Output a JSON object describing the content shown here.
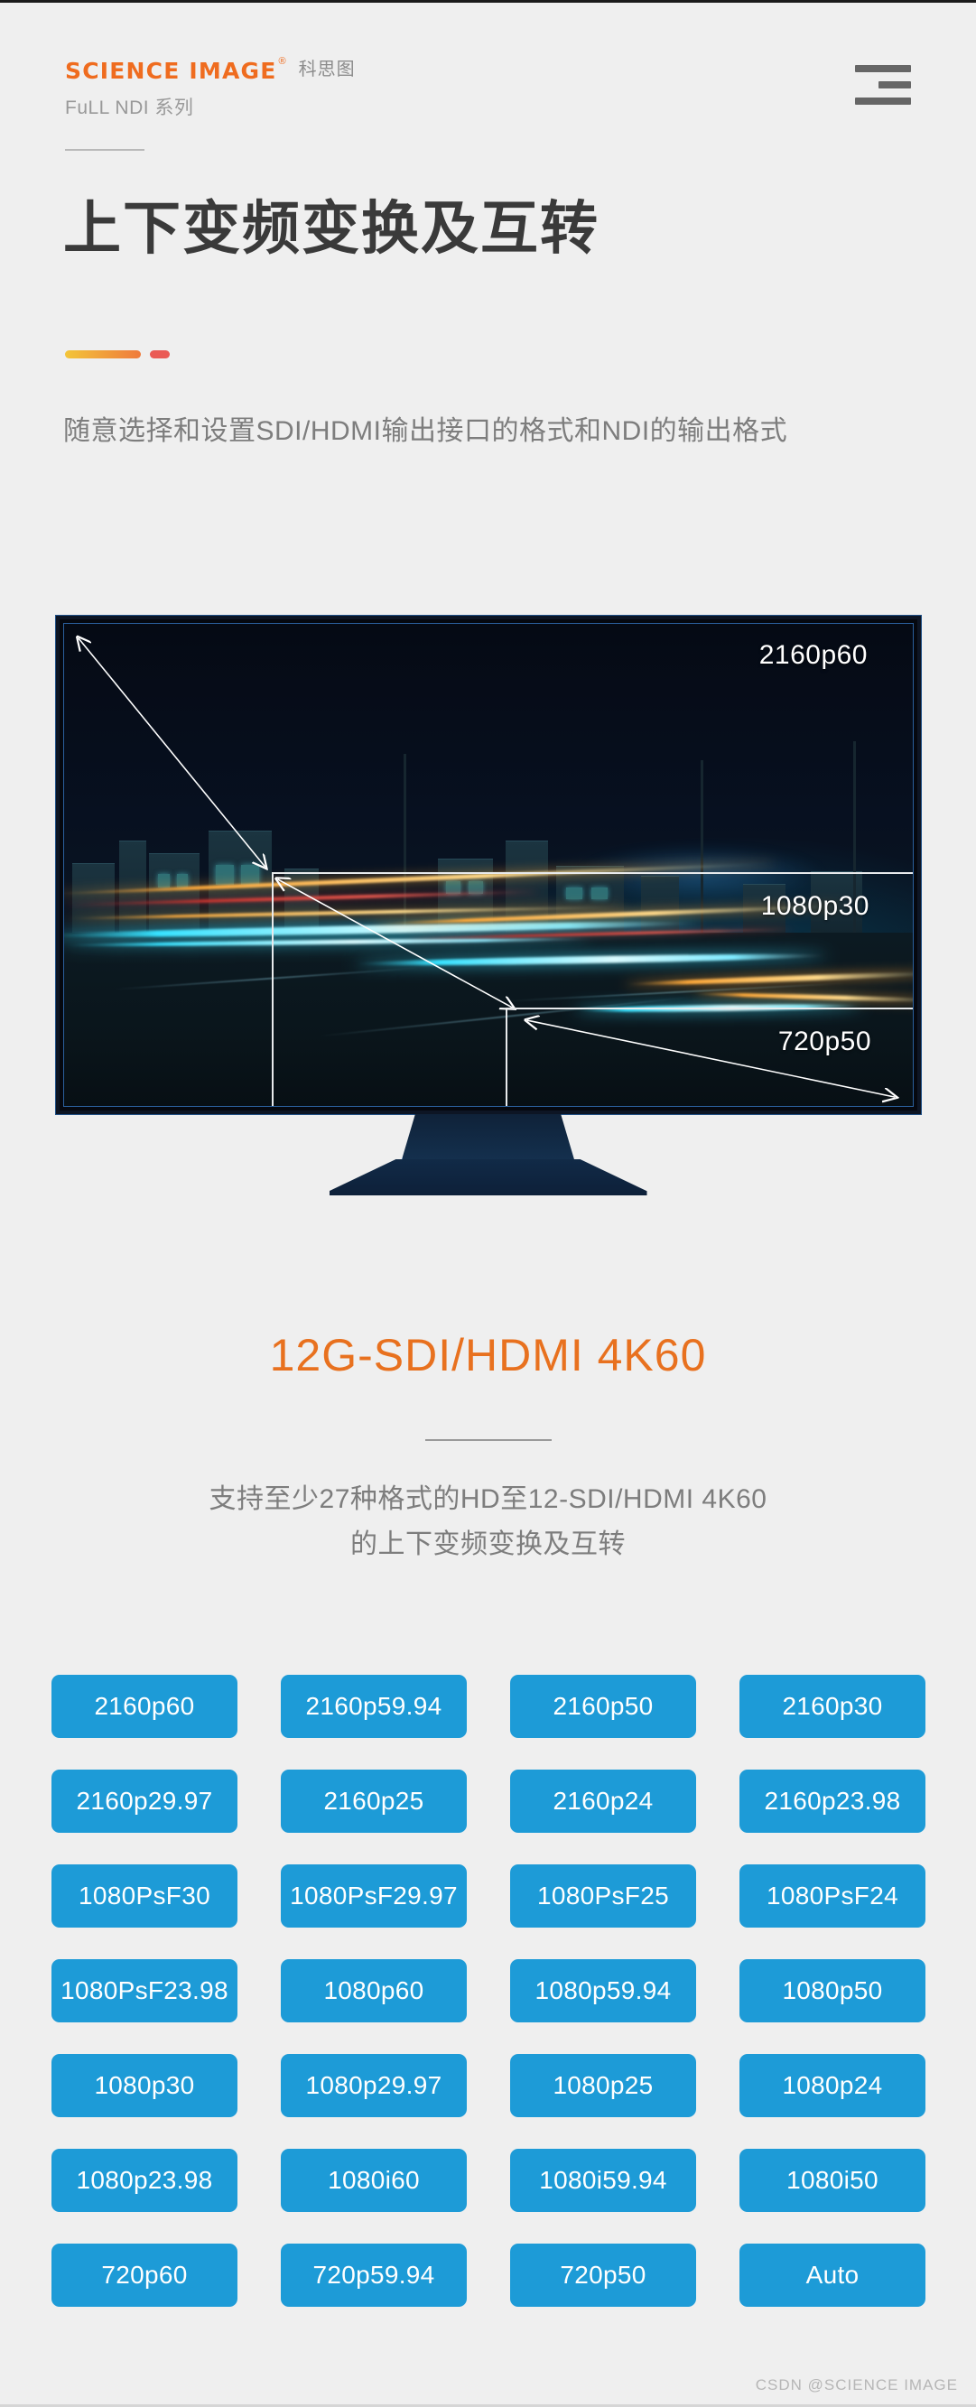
{
  "header": {
    "brand_mark": "SCIENCE IMAGE",
    "brand_reg": "®",
    "brand_cn": "科思图",
    "brand_series": "FuLL NDI 系列",
    "menu_icon": "hamburger-menu-icon"
  },
  "title": {
    "main": "上下变频变换及互转",
    "subtitle": "随意选择和设置SDI/HDMI输出接口的格式和NDI的输出格式"
  },
  "tv": {
    "frames": [
      {
        "label": "2160p60"
      },
      {
        "label": "1080p30"
      },
      {
        "label": "720p50"
      }
    ]
  },
  "feature": {
    "headline": "12G-SDI/HDMI 4K60",
    "description_line1": "支持至少27种格式的HD至12-SDI/HDMI 4K60",
    "description_line2": "的上下变频变换及互转"
  },
  "formats": [
    "2160p60",
    "2160p59.94",
    "2160p50",
    "2160p30",
    "2160p29.97",
    "2160p25",
    "2160p24",
    "2160p23.98",
    "1080PsF30",
    "1080PsF29.97",
    "1080PsF25",
    "1080PsF24",
    "1080PsF23.98",
    "1080p60",
    "1080p59.94",
    "1080p50",
    "1080p30",
    "1080p29.97",
    "1080p25",
    "1080p24",
    "1080p23.98",
    "1080i60",
    "1080i59.94",
    "1080i50",
    "720p60",
    "720p59.94",
    "720p50",
    "Auto"
  ],
  "footer": {
    "watermark": "CSDN @SCIENCE IMAGE"
  },
  "colors": {
    "background": "#efefef",
    "brand_orange": "#ef6c1f",
    "headline_orange": "#e8711f",
    "badge_blue": "#1d9bd7",
    "title_gray": "#3a3a3a",
    "body_gray": "#7d7d7d",
    "accent_gradient_start": "#f3c53a",
    "accent_gradient_end": "#ef7a3c",
    "accent_dot": "#ea5a55"
  }
}
